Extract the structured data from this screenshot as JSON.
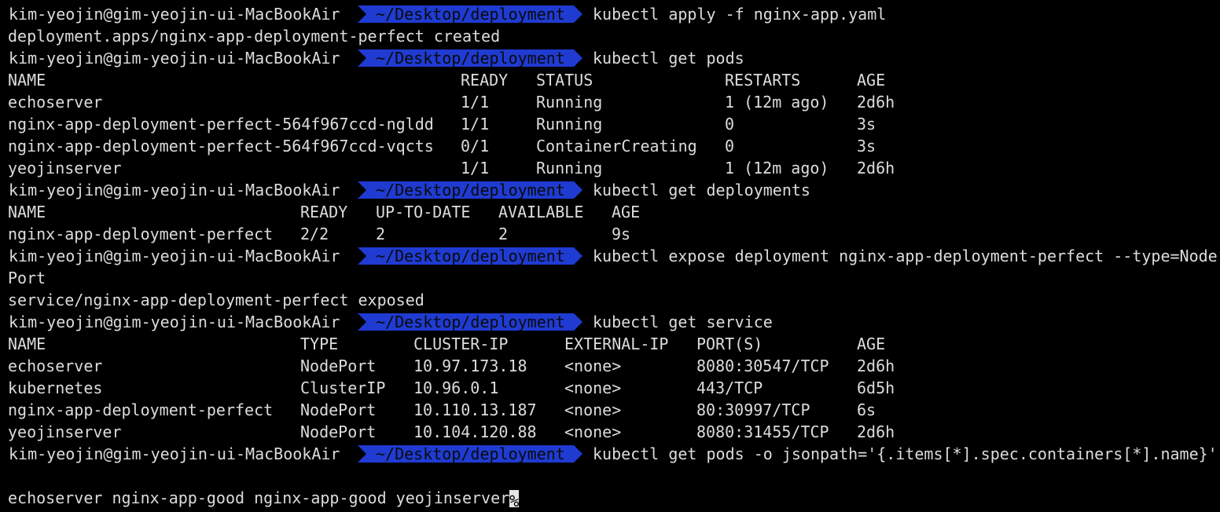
{
  "theme": {
    "background": "#000000",
    "foreground": "#dcdcdc",
    "path_segment_color": "#1f3bd1"
  },
  "prompt": {
    "user_host": "kim-yeojin@gim-yeojin-ui-MacBookAir",
    "path": "~/Desktop/deployment"
  },
  "commands": [
    "kubectl apply -f nginx-app.yaml",
    "kubectl get pods",
    "kubectl get deployments",
    "kubectl expose deployment nginx-app-deployment-perfect --type=Node",
    "kubectl get service",
    "kubectl get pods -o jsonpath='{.items[*].spec.containers[*].name}'"
  ],
  "outputs": {
    "apply_result": "deployment.apps/nginx-app-deployment-perfect created",
    "expose_wrap": "Port",
    "expose_result": "service/nginx-app-deployment-perfect exposed",
    "jsonpath_result": "echoserver nginx-app-good nginx-app-good yeojinserver",
    "cursor_char": "%"
  },
  "pods_table": {
    "headers": [
      "NAME",
      "READY",
      "STATUS",
      "RESTARTS",
      "AGE"
    ],
    "rows": [
      [
        "echoserver",
        "1/1",
        "Running",
        "1 (12m ago)",
        "2d6h"
      ],
      [
        "nginx-app-deployment-perfect-564f967ccd-ngldd",
        "1/1",
        "Running",
        "0",
        "3s"
      ],
      [
        "nginx-app-deployment-perfect-564f967ccd-vqcts",
        "0/1",
        "ContainerCreating",
        "0",
        "3s"
      ],
      [
        "yeojinserver",
        "1/1",
        "Running",
        "1 (12m ago)",
        "2d6h"
      ]
    ]
  },
  "deployments_table": {
    "headers": [
      "NAME",
      "READY",
      "UP-TO-DATE",
      "AVAILABLE",
      "AGE"
    ],
    "rows": [
      [
        "nginx-app-deployment-perfect",
        "2/2",
        "2",
        "2",
        "9s"
      ]
    ]
  },
  "services_table": {
    "headers": [
      "NAME",
      "TYPE",
      "CLUSTER-IP",
      "EXTERNAL-IP",
      "PORT(S)",
      "AGE"
    ],
    "rows": [
      [
        "echoserver",
        "NodePort",
        "10.97.173.18",
        "<none>",
        "8080:30547/TCP",
        "2d6h"
      ],
      [
        "kubernetes",
        "ClusterIP",
        "10.96.0.1",
        "<none>",
        "443/TCP",
        "6d5h"
      ],
      [
        "nginx-app-deployment-perfect",
        "NodePort",
        "10.110.13.187",
        "<none>",
        "80:30997/TCP",
        "6s"
      ],
      [
        "yeojinserver",
        "NodePort",
        "10.104.120.88",
        "<none>",
        "8080:31455/TCP",
        "2d6h"
      ]
    ]
  }
}
